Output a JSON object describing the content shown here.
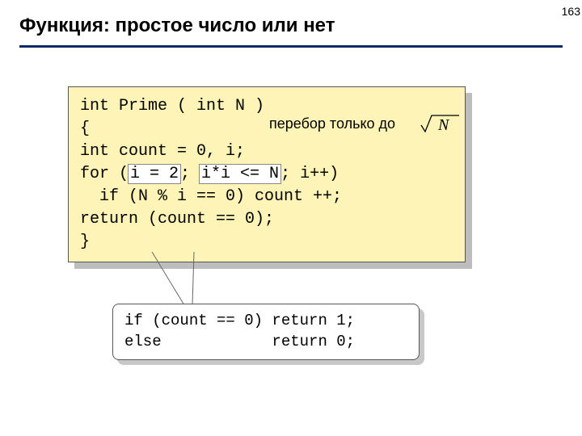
{
  "page_number": "163",
  "title": "Функция: простое число или нет",
  "code": {
    "line1_a": "int Prime ( int N )",
    "line2_a": "{",
    "line3_a": "int count = 0, i;",
    "line4_a": "for (",
    "line4_hl1": "i = 2",
    "line4_b": "; ",
    "line4_hl2": "i*i <= N",
    "line4_c": "; i++)",
    "line5_a": "  if (N % i == 0) count ++;",
    "line6_a": "return (count == 0);",
    "line7_a": "}"
  },
  "annotation": "перебор только до",
  "sqrt_label": "N",
  "callout": {
    "line1": "if (count == 0) return 1;",
    "line2": "else            return 0;"
  }
}
